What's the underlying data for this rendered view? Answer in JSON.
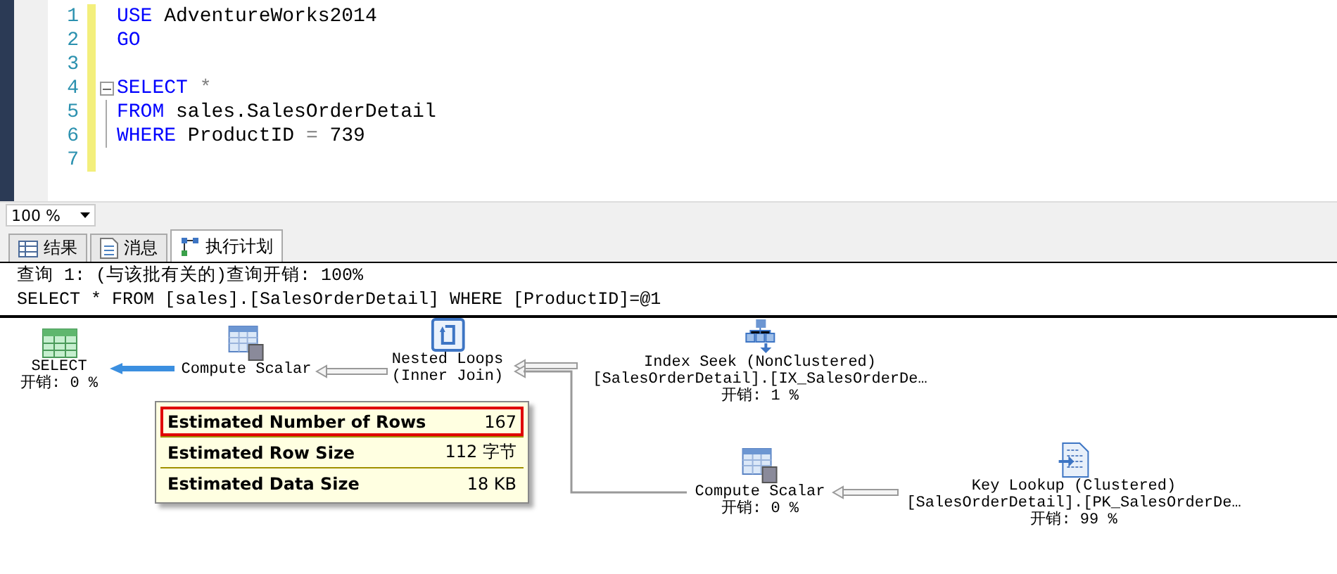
{
  "editor": {
    "lines": [
      {
        "number": "1",
        "fold": false,
        "segments": [
          {
            "kind": "keyword",
            "text": "USE"
          },
          {
            "kind": "plain",
            "text": " AdventureWorks2014"
          }
        ]
      },
      {
        "number": "2",
        "fold": false,
        "segments": [
          {
            "kind": "keyword",
            "text": "GO"
          }
        ]
      },
      {
        "number": "3",
        "fold": false
      },
      {
        "number": "4",
        "fold": true,
        "segments": [
          {
            "kind": "keyword",
            "text": "SELECT"
          },
          {
            "kind": "operator",
            "text": " *"
          }
        ]
      },
      {
        "number": "5",
        "fold": false,
        "segments": [
          {
            "kind": "keyword",
            "text": "FROM"
          },
          {
            "kind": "plain",
            "text": " sales.SalesOrderDetail"
          }
        ]
      },
      {
        "number": "6",
        "fold": false,
        "segments": [
          {
            "kind": "keyword",
            "text": "WHERE"
          },
          {
            "kind": "plain",
            "text": " ProductID "
          },
          {
            "kind": "operator",
            "text": "="
          },
          {
            "kind": "plain",
            "text": " 739"
          }
        ]
      },
      {
        "number": "7",
        "fold": false
      }
    ]
  },
  "zoom": "100 %",
  "tabs": [
    {
      "label": "结果",
      "kind": "grid",
      "selected": false
    },
    {
      "label": "消息",
      "kind": "messages",
      "selected": false
    },
    {
      "label": "执行计划",
      "kind": "plan",
      "selected": true
    }
  ],
  "query_header": {
    "title": "查询 1: (与该批有关的)查询开销: 100%",
    "statement": "SELECT * FROM [sales].[SalesOrderDetail] WHERE [ProductID]=@1"
  },
  "plan_nodes": [
    {
      "kind": "select",
      "name": "SELECT",
      "cost": "开销: 0 %"
    },
    {
      "kind": "compute",
      "name": "Compute Scalar"
    },
    {
      "kind": "nested",
      "name": "Nested Loops",
      "detail": "(Inner Join)"
    },
    {
      "kind": "seek",
      "name": "Index Seek (NonClustered)",
      "object": "[SalesOrderDetail].[IX_SalesOrderDe…",
      "cost": "开销: 1 %"
    },
    {
      "kind": "compute",
      "name": "Compute Scalar",
      "cost": "开销: 0 %"
    },
    {
      "kind": "lookup",
      "name": "Key Lookup (Clustered)",
      "object": "[SalesOrderDetail].[PK_SalesOrderDe…",
      "cost": "开销: 99 %"
    }
  ],
  "tooltip": [
    {
      "label": "Estimated Number of Rows",
      "value": "167",
      "highlighted": true
    },
    {
      "label": "Estimated Row Size",
      "value": "112 字节",
      "highlighted": false
    },
    {
      "label": "Estimated Data Size",
      "value": "18 KB",
      "highlighted": false
    }
  ]
}
